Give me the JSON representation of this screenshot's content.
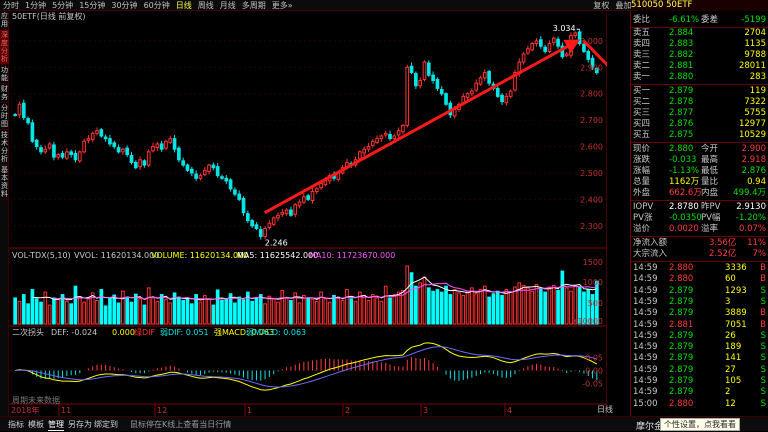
{
  "toolbar": {
    "items": [
      "分时",
      "1分钟",
      "5分钟",
      "15分钟",
      "30分钟",
      "60分钟",
      "日线",
      "周线",
      "月线",
      "多周期",
      "更多»"
    ],
    "active_index": 6,
    "right_items": [
      "复权",
      "叠加",
      "统计",
      "画线",
      "F10",
      "标记",
      "-自选",
      "返回"
    ]
  },
  "left_nav": {
    "items": [
      "应用",
      "深度分析",
      "功能",
      "财务",
      "分时图",
      "技术分析",
      "基本资料"
    ]
  },
  "main": {
    "title": "50ETF(日线 前复权)",
    "price_max": "3.034",
    "price_min": "2.246",
    "y_axis": [
      "3.000",
      "2.900",
      "2.800",
      "2.700",
      "2.600",
      "2.500",
      "2.400",
      "2.300"
    ],
    "period_button": "日线"
  },
  "vol": {
    "title": "VOL-TDX(5,10)",
    "vvol": "VVOL: 11620134.000",
    "volume": "VOLUME: 11620134.000",
    "ma5": "MA5: 11625542.000",
    "ma10": "MA10: 11723670.000",
    "y_axis": [
      "1500",
      "1000",
      "500",
      "X10000"
    ]
  },
  "macd": {
    "title": "二次拐头",
    "def": "DEF: -0.024",
    "v1": "0.000",
    "c1": "绿DIF",
    "v2": "弱DIF: 0.051",
    "v3": "强MACD: 0.063",
    "c2": "弱MACD: 0.063",
    "y_axis": [
      "0.05",
      "0.00",
      "-0.05"
    ],
    "watermark": "周期未来数据"
  },
  "date_axis": [
    "2018年",
    "11",
    "12",
    "1",
    "2",
    "3",
    "4"
  ],
  "quote": {
    "code_name": "510050 50ETF",
    "wb_label": "委比",
    "wb_val": "-6.61%",
    "wc_label": "委差",
    "wc_val": "-5199",
    "asks": [
      {
        "l": "卖五",
        "p": "2.884",
        "v": "2704"
      },
      {
        "l": "卖四",
        "p": "2.883",
        "v": "1135"
      },
      {
        "l": "卖三",
        "p": "2.882",
        "v": "9788"
      },
      {
        "l": "卖二",
        "p": "2.881",
        "v": "28011"
      },
      {
        "l": "卖一",
        "p": "2.880",
        "v": "283"
      }
    ],
    "bids": [
      {
        "l": "买一",
        "p": "2.879",
        "v": "119"
      },
      {
        "l": "买二",
        "p": "2.878",
        "v": "7322"
      },
      {
        "l": "买三",
        "p": "2.877",
        "v": "5755"
      },
      {
        "l": "买四",
        "p": "2.876",
        "v": "12977"
      },
      {
        "l": "买五",
        "p": "2.875",
        "v": "10529"
      }
    ],
    "stats": [
      [
        "现价",
        "2.880",
        "今开",
        "2.900"
      ],
      [
        "涨跌",
        "-0.033",
        "最高",
        "2.918"
      ],
      [
        "涨幅",
        "-1.13%",
        "最低",
        "2.876"
      ],
      [
        "总量",
        "1162万",
        "量比",
        "0.94"
      ],
      [
        "外盘",
        "662.6万",
        "内盘",
        "499.4万"
      ]
    ],
    "iopv": [
      [
        "IOPV",
        "2.8780",
        "昨PV",
        "2.9130"
      ],
      [
        "PV涨",
        "-0.0350",
        "PV幅",
        "-1.20%"
      ],
      [
        "溢价",
        "0.0020",
        "溢率",
        "0.07%"
      ]
    ],
    "flow": [
      [
        "净流入额",
        "3.56亿",
        "11%"
      ],
      [
        "大宗流入",
        "2.52亿",
        "7%"
      ]
    ],
    "ticks": [
      [
        "14:59",
        "2.880",
        "3336",
        "B"
      ],
      [
        "14:59",
        "2.880",
        "60",
        "B"
      ],
      [
        "14:59",
        "2.879",
        "1293",
        "S"
      ],
      [
        "14:59",
        "2.879",
        "3",
        "S"
      ],
      [
        "14:59",
        "2.879",
        "3889",
        "B"
      ],
      [
        "14:59",
        "2.881",
        "7051",
        "B"
      ],
      [
        "14:59",
        "2.879",
        "26",
        "S"
      ],
      [
        "14:59",
        "2.879",
        "189",
        "S"
      ],
      [
        "14:59",
        "2.879",
        "141",
        "S"
      ],
      [
        "14:59",
        "2.879",
        "27",
        "S"
      ],
      [
        "14:59",
        "2.879",
        "105",
        "S"
      ],
      [
        "14:59",
        "2.879",
        "2",
        "S"
      ],
      [
        "15:00",
        "2.880",
        "12",
        "S"
      ]
    ]
  },
  "bottom": {
    "items": [
      "指标",
      "模板",
      "管理",
      "另存为",
      "绑定到"
    ],
    "center_text": "鼠标停在K线上查看当日行情",
    "right": "日线",
    "logo": "摩尔金融",
    "tooltip": "个性设置，点我看看"
  },
  "colors": {
    "up": "#ff3232",
    "down": "#00e5e5",
    "vol_up": "#ff3232",
    "vol_down": "#00ffff",
    "arrow": "#ff1a1a",
    "yellow": "#ffff00",
    "green": "#00e000",
    "red": "#ff3c3c"
  },
  "chart_data": {
    "type": "candlestick",
    "ylim": [
      2.22,
      3.06
    ],
    "ylabels": [
      3.0,
      2.9,
      2.8,
      2.7,
      2.6,
      2.5,
      2.4,
      2.3
    ],
    "annotations": [
      {
        "text": "3.034"
      },
      {
        "text": "2.246"
      }
    ],
    "closes": [
      2.72,
      2.76,
      2.71,
      2.69,
      2.62,
      2.6,
      2.58,
      2.59,
      2.61,
      2.56,
      2.57,
      2.56,
      2.58,
      2.57,
      2.55,
      2.58,
      2.62,
      2.63,
      2.65,
      2.66,
      2.64,
      2.63,
      2.61,
      2.6,
      2.58,
      2.59,
      2.57,
      2.54,
      2.52,
      2.55,
      2.53,
      2.58,
      2.6,
      2.61,
      2.59,
      2.62,
      2.63,
      2.59,
      2.55,
      2.53,
      2.51,
      2.5,
      2.48,
      2.49,
      2.51,
      2.53,
      2.52,
      2.49,
      2.48,
      2.47,
      2.44,
      2.42,
      2.4,
      2.35,
      2.32,
      2.3,
      2.29,
      2.26,
      2.29,
      2.31,
      2.33,
      2.34,
      2.35,
      2.36,
      2.34,
      2.38,
      2.39,
      2.41,
      2.4,
      2.43,
      2.44,
      2.46,
      2.47,
      2.49,
      2.48,
      2.5,
      2.52,
      2.54,
      2.53,
      2.55,
      2.58,
      2.59,
      2.6,
      2.62,
      2.63,
      2.64,
      2.65,
      2.63,
      2.64,
      2.66,
      2.68,
      2.9,
      2.88,
      2.83,
      2.85,
      2.92,
      2.87,
      2.85,
      2.82,
      2.8,
      2.76,
      2.72,
      2.74,
      2.76,
      2.79,
      2.8,
      2.81,
      2.84,
      2.86,
      2.88,
      2.84,
      2.82,
      2.79,
      2.77,
      2.79,
      2.81,
      2.88,
      2.92,
      2.95,
      2.97,
      2.99,
      3.0,
      2.98,
      2.96,
      2.99,
      3.01,
      2.98,
      2.94,
      2.95,
      3.02,
      3.03,
      2.99,
      2.96,
      2.93,
      2.9,
      2.88
    ],
    "volumes": [
      620,
      540,
      700,
      480,
      820,
      600,
      520,
      760,
      450,
      620,
      580,
      700,
      540,
      480,
      900,
      650,
      520,
      600,
      740,
      560,
      820,
      430,
      610,
      690,
      500,
      780,
      640,
      520,
      710,
      600,
      450,
      860,
      620,
      540,
      700,
      580,
      500,
      740,
      640,
      560,
      600,
      480,
      700,
      520,
      680,
      590,
      450,
      810,
      560,
      600,
      720,
      500,
      640,
      580,
      760,
      540,
      620,
      700,
      480,
      660,
      590,
      520,
      800,
      610,
      560,
      740,
      500,
      680,
      620,
      590,
      540,
      760,
      600,
      520,
      680,
      640,
      560,
      820,
      600,
      540,
      760,
      680,
      560,
      700,
      620,
      540,
      900,
      620,
      700,
      760,
      800,
      1380,
      1220,
      900,
      980,
      1120,
      860,
      780,
      820,
      760,
      900,
      700,
      820,
      740,
      680,
      780,
      860,
      720,
      820,
      900,
      640,
      720,
      780,
      680,
      820,
      760,
      880,
      980,
      920,
      860,
      780,
      940,
      840,
      760,
      880,
      920,
      800,
      1260,
      860,
      780,
      920,
      880,
      760,
      820,
      700,
      1020
    ]
  }
}
